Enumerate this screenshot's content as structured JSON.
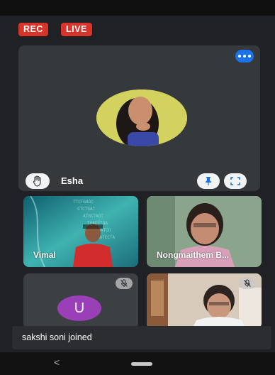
{
  "badges": {
    "rec": "REC",
    "live": "LIVE"
  },
  "main_tile": {
    "name": "Esha"
  },
  "tiles": [
    {
      "name": "Vimal"
    },
    {
      "name": "Nongmaithem B..."
    },
    {
      "avatar_letter": "U"
    }
  ],
  "toast": {
    "text": "sakshi soni joined"
  },
  "nav": {
    "back_symbol": "<"
  },
  "colors": {
    "accent": "#1a73e8",
    "recording": "#d7352b",
    "avatar_u": "#9b3fb8"
  },
  "icons": {
    "more": "more-icon",
    "raise_hand": "hand-icon",
    "pin": "pin-icon",
    "fullscreen": "fullscreen-icon",
    "muted": "mic-off-icon"
  }
}
